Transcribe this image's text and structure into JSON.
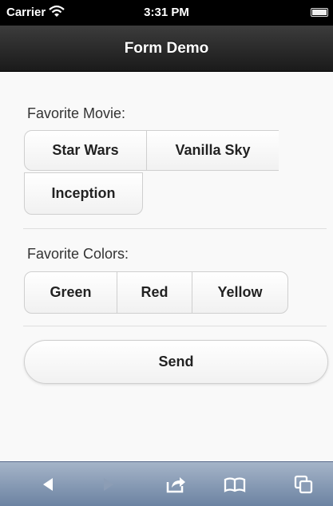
{
  "status_bar": {
    "carrier": "Carrier",
    "time": "3:31 PM"
  },
  "header": {
    "title": "Form Demo"
  },
  "form": {
    "movie": {
      "label": "Favorite Movie:",
      "options": [
        "Star Wars",
        "Vanilla Sky",
        "Inception"
      ]
    },
    "colors": {
      "label": "Favorite Colors:",
      "options": [
        "Green",
        "Red",
        "Yellow"
      ]
    },
    "send_label": "Send"
  },
  "toolbar": {
    "icons": [
      "back-arrow-icon",
      "forward-arrow-icon",
      "share-icon",
      "bookmarks-icon",
      "tabs-icon"
    ]
  }
}
